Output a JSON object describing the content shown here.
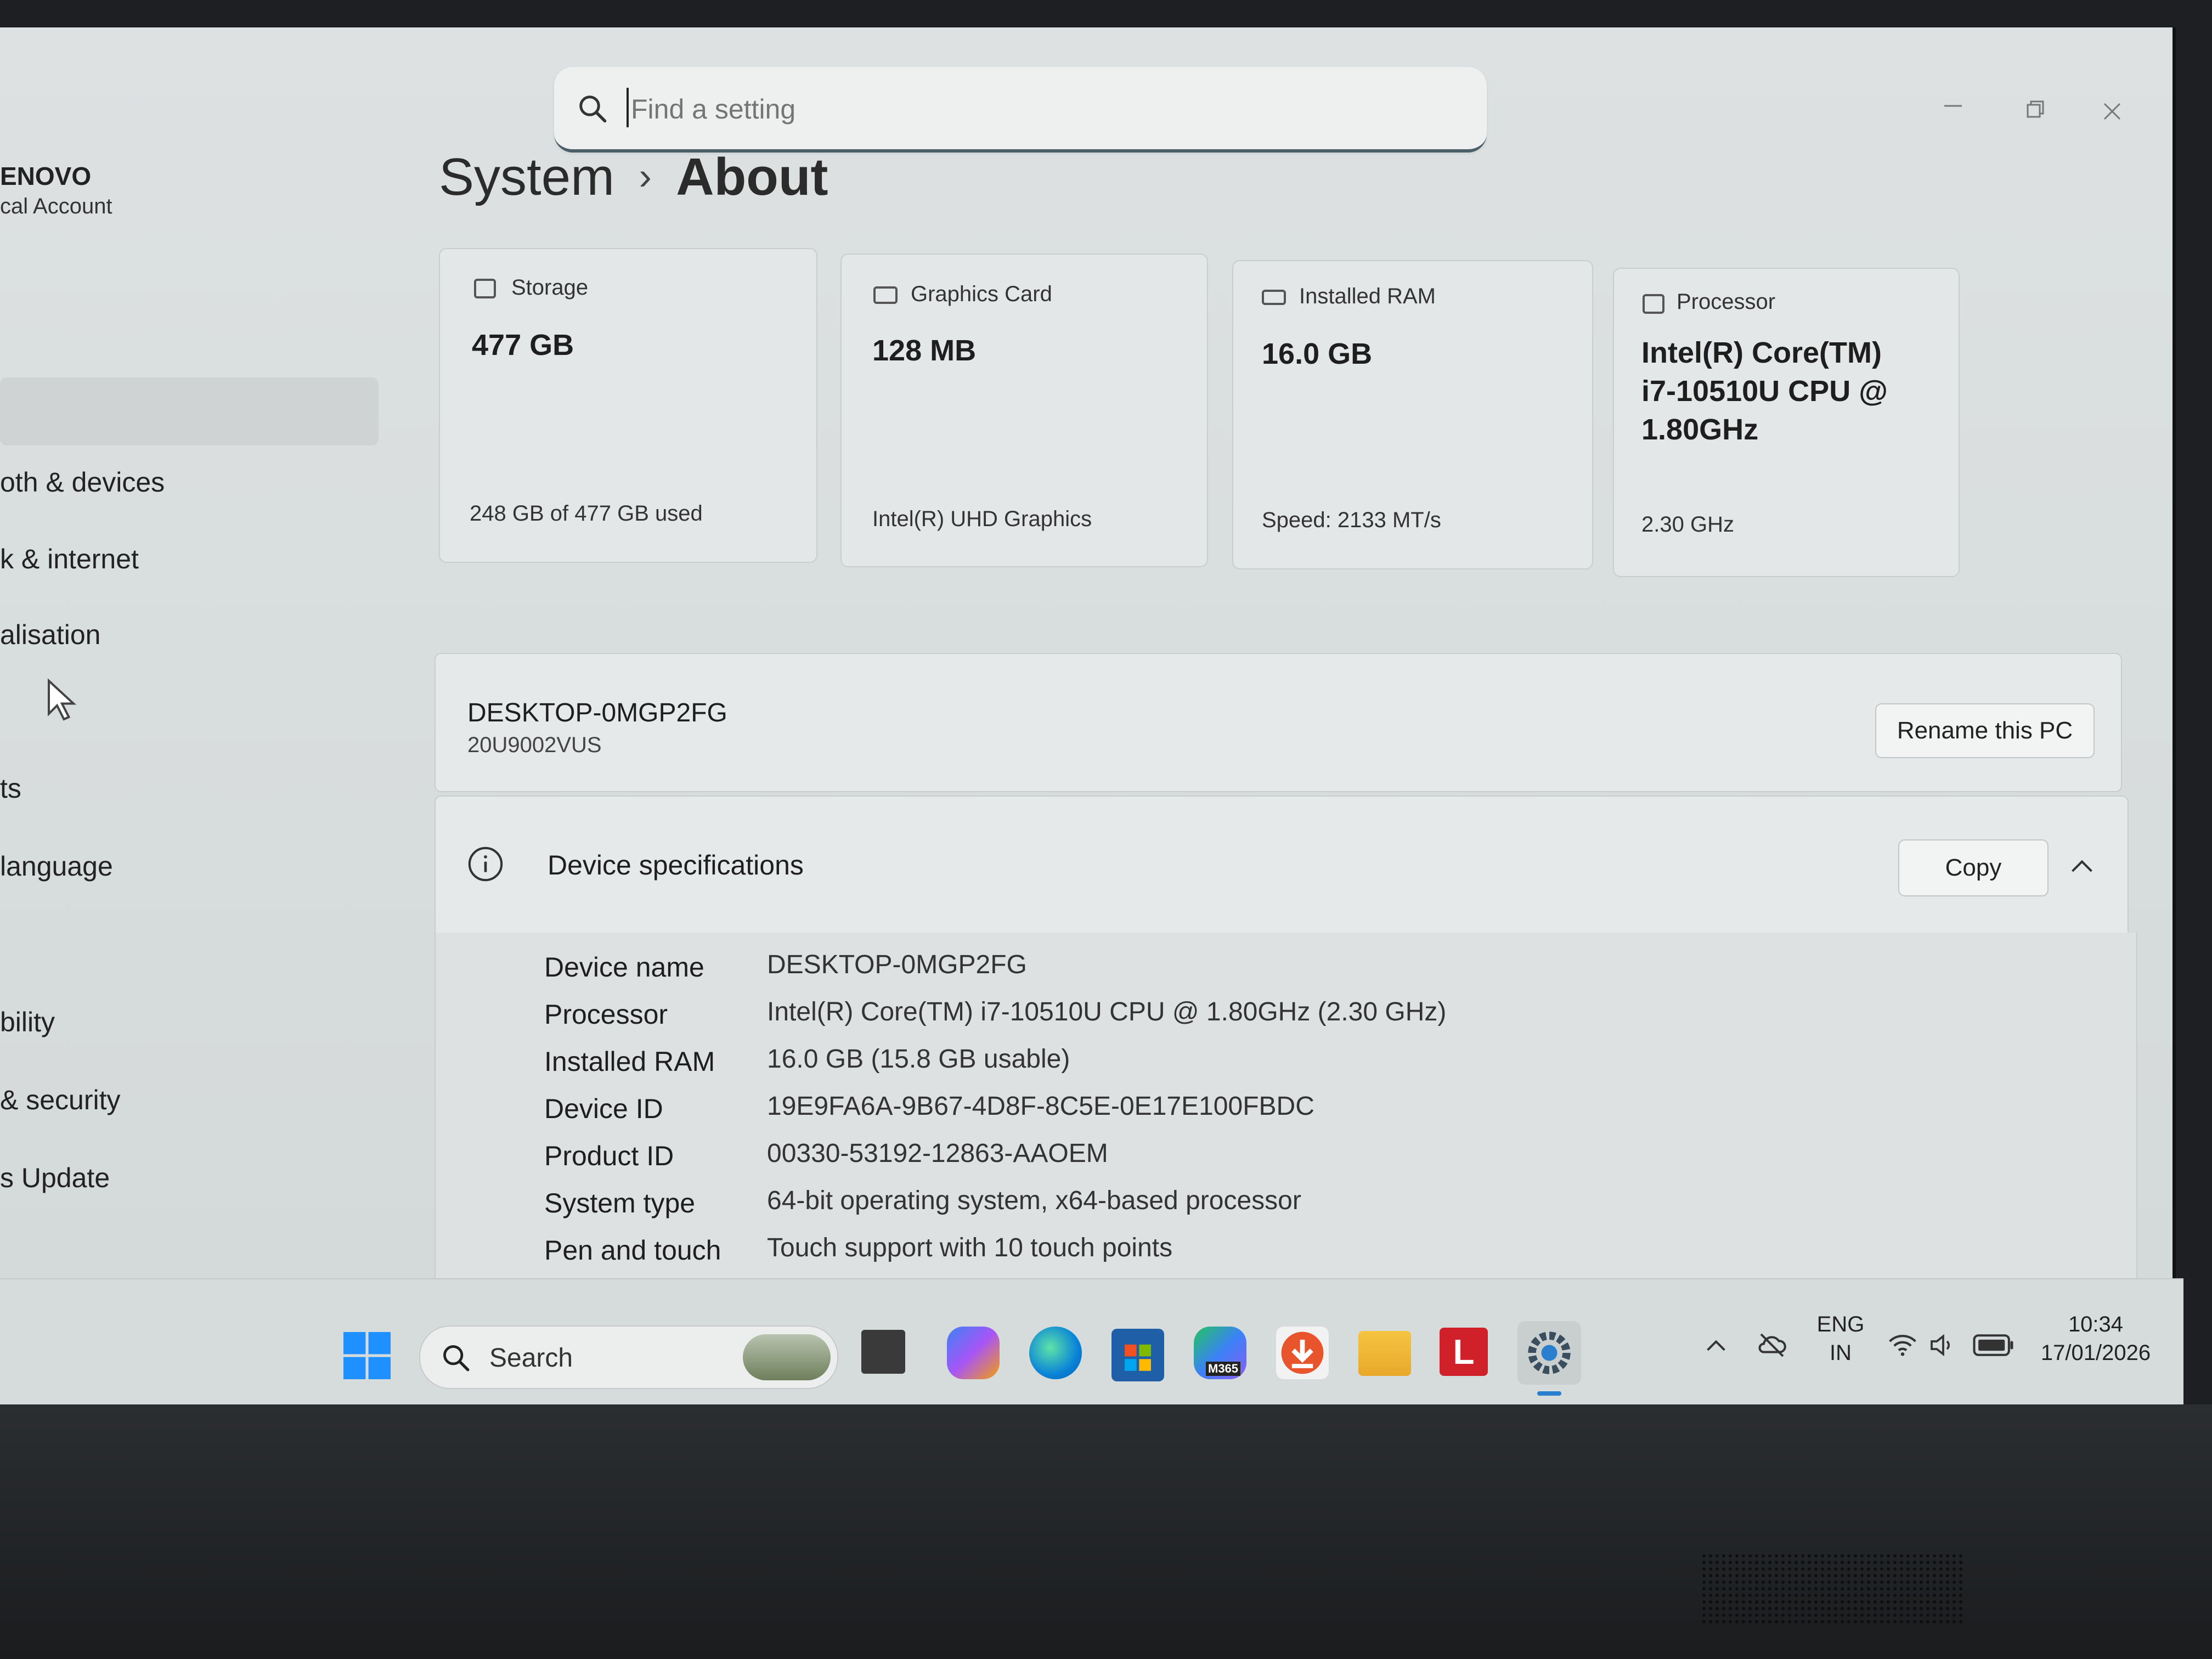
{
  "search": {
    "placeholder": "Find a setting"
  },
  "account": {
    "name": "ENOVO",
    "type": "cal Account"
  },
  "sidebar": {
    "items": [
      {
        "label": "oth & devices"
      },
      {
        "label": "k & internet"
      },
      {
        "label": "alisation"
      },
      {
        "label": "ts"
      },
      {
        "label": "language"
      },
      {
        "label": "bility"
      },
      {
        "label": "& security"
      },
      {
        "label": "s Update"
      }
    ]
  },
  "breadcrumb": {
    "parent": "System",
    "separator": "›",
    "current": "About"
  },
  "tiles": [
    {
      "label": "Storage",
      "value": "477 GB",
      "sub": "248 GB of 477 GB used"
    },
    {
      "label": "Graphics Card",
      "value": "128 MB",
      "sub": "Intel(R) UHD Graphics"
    },
    {
      "label": "Installed RAM",
      "value": "16.0 GB",
      "sub": "Speed: 2133 MT/s"
    },
    {
      "label": "Processor",
      "value_lines": [
        "Intel(R) Core(TM)",
        "i7-10510U CPU @",
        "1.80GHz"
      ],
      "sub": "2.30 GHz"
    }
  ],
  "pc": {
    "name": "DESKTOP-0MGP2FG",
    "model": "20U9002VUS",
    "rename_label": "Rename this PC"
  },
  "specs": {
    "title": "Device specifications",
    "copy_label": "Copy",
    "rows": [
      {
        "key": "Device name",
        "value": "DESKTOP-0MGP2FG"
      },
      {
        "key": "Processor",
        "value": "Intel(R) Core(TM) i7-10510U CPU @ 1.80GHz (2.30 GHz)"
      },
      {
        "key": "Installed RAM",
        "value": "16.0 GB (15.8 GB usable)"
      },
      {
        "key": "Device ID",
        "value": "19E9FA6A-9B67-4D8F-8C5E-0E17E100FBDC"
      },
      {
        "key": "Product ID",
        "value": "00330-53192-12863-AAOEM"
      },
      {
        "key": "System type",
        "value": "64-bit operating system, x64-based processor"
      },
      {
        "key": "Pen and touch",
        "value": "Touch support with 10 touch points"
      }
    ]
  },
  "taskbar": {
    "search_label": "Search",
    "m365_badge": "M365",
    "l_app_letter": "L",
    "language": "ENG",
    "region": "IN",
    "time": "10:34",
    "date": "17/01/2026"
  },
  "colors": {
    "accent": "#0067c0",
    "windows_logo": "#1e90ff",
    "l_app": "#d0202a"
  }
}
